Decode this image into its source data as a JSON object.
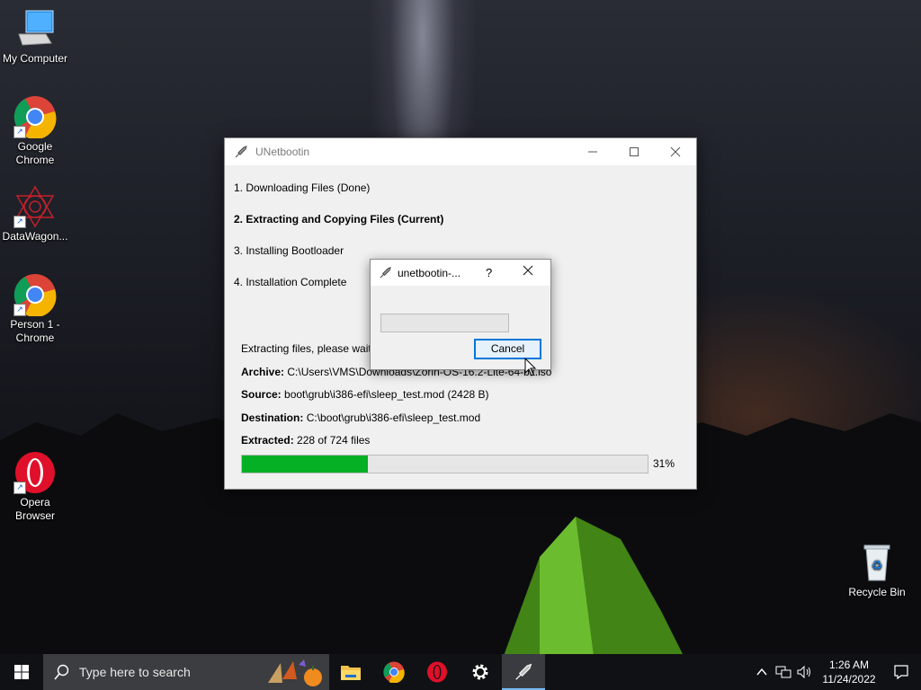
{
  "desktop": {
    "icons": [
      {
        "label": "My Computer"
      },
      {
        "label": "Google Chrome"
      },
      {
        "label": "DataWagon..."
      },
      {
        "label": "Person 1 - Chrome"
      },
      {
        "label": "Opera Browser"
      },
      {
        "label": "Recycle Bin"
      }
    ]
  },
  "main_window": {
    "title": "UNetbootin",
    "steps": [
      {
        "label": "1. Downloading Files (Done)"
      },
      {
        "label": "2. Extracting and Copying Files (Current)"
      },
      {
        "label": "3. Installing Bootloader"
      },
      {
        "label": "4. Installation Complete"
      }
    ],
    "status": "Extracting files, please wait...",
    "archive_label": "Archive:",
    "archive_value": "C:\\Users\\VMS\\Downloads\\Zorin-OS-16.2-Lite-64-bit.iso",
    "source_label": "Source:",
    "source_value": "boot\\grub\\i386-efi\\sleep_test.mod (2428 B)",
    "destination_label": "Destination:",
    "destination_value": "C:\\boot\\grub\\i386-efi\\sleep_test.mod",
    "extracted_label": "Extracted:",
    "extracted_value": "228 of 724 files",
    "progress_percent": 31,
    "progress_text": "31%"
  },
  "sub_dialog": {
    "title": "unetbootin-...",
    "help": "?",
    "progress_percent": 0,
    "cancel_label": "Cancel"
  },
  "taskbar": {
    "search_placeholder": "Type here to search",
    "apps": [
      "file-explorer",
      "google-chrome",
      "opera",
      "settings",
      "unetbootin"
    ],
    "time": "1:26 AM",
    "date": "11/24/2022"
  },
  "colors": {
    "progress_fill": "#06b025",
    "focus_border": "#0078d7",
    "taskbar_bg": "#101114"
  }
}
